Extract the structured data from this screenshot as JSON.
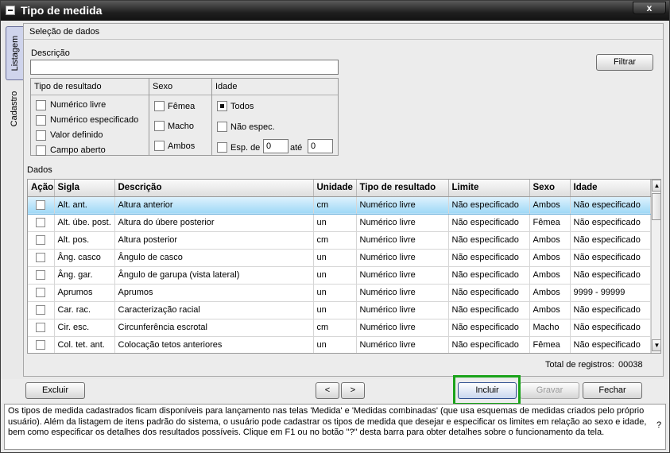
{
  "window": {
    "title": "Tipo de medida",
    "close_glyph": "x"
  },
  "side_tabs": [
    {
      "label": "Listagem"
    },
    {
      "label": "Cadastro"
    }
  ],
  "filter": {
    "section_title": "Seleção de dados",
    "descricao_label": "Descrição",
    "descricao_value": "",
    "filtrar_button": "Filtrar",
    "tipo_resultado": {
      "title": "Tipo de resultado",
      "options": [
        {
          "label": "Numérico livre",
          "checked": false
        },
        {
          "label": "Numérico especificado",
          "checked": false
        },
        {
          "label": "Valor definido",
          "checked": false
        },
        {
          "label": "Campo aberto",
          "checked": false
        }
      ]
    },
    "sexo": {
      "title": "Sexo",
      "options": [
        {
          "label": "Fêmea",
          "checked": false
        },
        {
          "label": "Macho",
          "checked": false
        },
        {
          "label": "Ambos",
          "checked": false
        }
      ]
    },
    "idade": {
      "title": "Idade",
      "options": [
        {
          "label": "Todos",
          "checked": true
        },
        {
          "label": "Não espec.",
          "checked": false
        },
        {
          "label": "Esp. de",
          "checked": false
        }
      ],
      "de_value": "0",
      "ate_label": "até",
      "ate_value": "0"
    }
  },
  "dados": {
    "title": "Dados",
    "columns": [
      "Ação",
      "Sigla",
      "Descrição",
      "Unidade",
      "Tipo de resultado",
      "Limite",
      "Sexo",
      "Idade"
    ],
    "rows": [
      {
        "sigla": "Alt. ant.",
        "descricao": "Altura anterior",
        "unidade": "cm",
        "tipo": "Numérico livre",
        "limite": "Não especificado",
        "sexo": "Ambos",
        "idade": "Não especificado"
      },
      {
        "sigla": "Alt. úbe. post.",
        "descricao": "Altura do úbere posterior",
        "unidade": "un",
        "tipo": "Numérico livre",
        "limite": "Não especificado",
        "sexo": "Fêmea",
        "idade": "Não especificado"
      },
      {
        "sigla": "Alt. pos.",
        "descricao": "Altura posterior",
        "unidade": "cm",
        "tipo": "Numérico livre",
        "limite": "Não especificado",
        "sexo": "Ambos",
        "idade": "Não especificado"
      },
      {
        "sigla": "Âng. casco",
        "descricao": "Ângulo de casco",
        "unidade": "un",
        "tipo": "Numérico livre",
        "limite": "Não especificado",
        "sexo": "Ambos",
        "idade": "Não especificado"
      },
      {
        "sigla": "Âng. gar.",
        "descricao": "Ângulo de garupa (vista lateral)",
        "unidade": "un",
        "tipo": "Numérico livre",
        "limite": "Não especificado",
        "sexo": "Ambos",
        "idade": "Não especificado"
      },
      {
        "sigla": "Aprumos",
        "descricao": "Aprumos",
        "unidade": "un",
        "tipo": "Numérico livre",
        "limite": "Não especificado",
        "sexo": "Ambos",
        "idade": "9999 - 99999"
      },
      {
        "sigla": "Car. rac.",
        "descricao": "Caracterização racial",
        "unidade": "un",
        "tipo": "Numérico livre",
        "limite": "Não especificado",
        "sexo": "Ambos",
        "idade": "Não especificado"
      },
      {
        "sigla": "Cir. esc.",
        "descricao": "Circunferência escrotal",
        "unidade": "cm",
        "tipo": "Numérico livre",
        "limite": "Não especificado",
        "sexo": "Macho",
        "idade": "Não especificado"
      },
      {
        "sigla": "Col. tet. ant.",
        "descricao": "Colocação tetos anteriores",
        "unidade": "un",
        "tipo": "Numérico livre",
        "limite": "Não especificado",
        "sexo": "Fêmea",
        "idade": "Não especificado"
      }
    ],
    "selected_row": 0,
    "total_label": "Total de registros:",
    "total_value": "00038"
  },
  "actions": {
    "excluir": "Excluir",
    "prev": "<",
    "next": ">",
    "incluir": "Incluir",
    "gravar": "Gravar",
    "fechar": "Fechar"
  },
  "help": {
    "text": "Os tipos de medida cadastrados ficam disponíveis para lançamento nas telas 'Medida' e 'Medidas combinadas' (que usa esquemas de medidas criados pelo próprio usuário). Além da listagem de itens padrão do sistema, o usuário pode cadastrar os tipos de medida que desejar e especificar os limites em relação ao sexo e idade, bem como especificar os detalhes dos resultados possíveis. Clique em F1 ou no botão \"?\" desta barra para obter detalhes sobre o funcionamento da tela.",
    "question_glyph": "?"
  },
  "colors": {
    "highlight": "#1aa31a",
    "selected_row": "#9fd8f6"
  }
}
